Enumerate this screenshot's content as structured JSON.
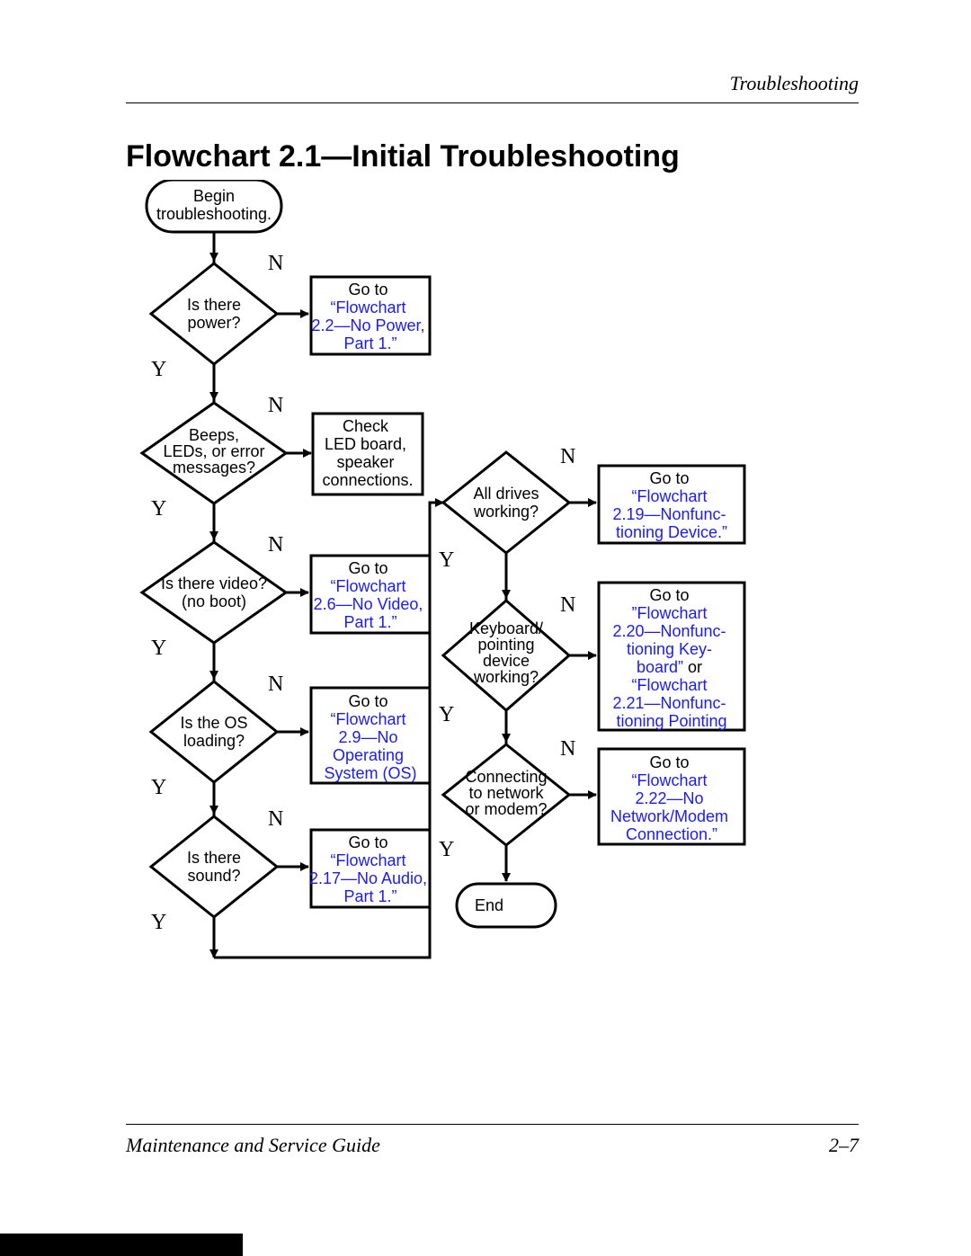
{
  "header": "Troubleshooting",
  "title": "Flowchart 2.1—Initial Troubleshooting",
  "footer_left": "Maintenance and Service Guide",
  "footer_right": "2–7",
  "labels": {
    "yes": "Y",
    "no": "N"
  },
  "chart_data": {
    "type": "table",
    "nodes": {
      "begin": {
        "kind": "terminator",
        "text": "Begin\ntroubleshooting."
      },
      "power": {
        "kind": "decision",
        "text": "Is there\npower?"
      },
      "power_ref": {
        "kind": "process",
        "plain": "Go to",
        "link": "“Flowchart\n2.2—No Power,\nPart 1.”"
      },
      "beeps": {
        "kind": "decision",
        "text": "Beeps,\nLEDs, or error\nmessages?"
      },
      "beeps_ref": {
        "kind": "process",
        "plain": "Check\nLED board,\nspeaker\nconnections."
      },
      "video": {
        "kind": "decision",
        "text": "Is there video?\n(no boot)"
      },
      "video_ref": {
        "kind": "process",
        "plain": "Go to",
        "link": "“Flowchart\n2.6—No Video,\nPart 1.”"
      },
      "os": {
        "kind": "decision",
        "text": "Is the OS\nloading?"
      },
      "os_ref": {
        "kind": "process",
        "plain": "Go to",
        "link": "“Flowchart\n2.9—No\nOperating\nSystem (OS)"
      },
      "sound": {
        "kind": "decision",
        "text": "Is there\nsound?"
      },
      "sound_ref": {
        "kind": "process",
        "plain": "Go to",
        "link": "“Flowchart\n2.17—No Audio,\nPart 1.”"
      },
      "drives": {
        "kind": "decision",
        "text": "All drives\nworking?"
      },
      "drives_ref": {
        "kind": "process",
        "plain": "Go to",
        "link": "“Flowchart\n2.19—Nonfunc-\ntioning Device.”"
      },
      "kbd": {
        "kind": "decision",
        "text": "Keyboard/\npointing\ndevice\nworking?"
      },
      "kbd_ref": {
        "kind": "process",
        "plain": "Go to",
        "link1": "”Flowchart\n2.20—Nonfunc-\ntioning Key-\nboard”",
        "mid": " or",
        "link2": "“Flowchart\n2.21—Nonfunc-\ntioning Pointing"
      },
      "net": {
        "kind": "decision",
        "text": "Connecting\nto network\nor modem?"
      },
      "net_ref": {
        "kind": "process",
        "plain": "Go to",
        "link": "“Flowchart\n2.22—No\nNetwork/Modem\nConnection.”"
      },
      "end": {
        "kind": "terminator",
        "text": "End"
      }
    },
    "edges": [
      {
        "from": "begin",
        "to": "power"
      },
      {
        "from": "power",
        "to": "beeps",
        "label": "Y"
      },
      {
        "from": "power",
        "to": "power_ref",
        "label": "N"
      },
      {
        "from": "beeps",
        "to": "video",
        "label": "Y"
      },
      {
        "from": "beeps",
        "to": "beeps_ref",
        "label": "N"
      },
      {
        "from": "video",
        "to": "os",
        "label": "Y"
      },
      {
        "from": "video",
        "to": "video_ref",
        "label": "N"
      },
      {
        "from": "os",
        "to": "sound",
        "label": "Y"
      },
      {
        "from": "os",
        "to": "os_ref",
        "label": "N"
      },
      {
        "from": "sound",
        "to": "drives",
        "label": "Y"
      },
      {
        "from": "sound",
        "to": "sound_ref",
        "label": "N"
      },
      {
        "from": "drives",
        "to": "kbd",
        "label": "Y"
      },
      {
        "from": "drives",
        "to": "drives_ref",
        "label": "N"
      },
      {
        "from": "kbd",
        "to": "net",
        "label": "Y"
      },
      {
        "from": "kbd",
        "to": "kbd_ref",
        "label": "N"
      },
      {
        "from": "net",
        "to": "end",
        "label": "Y"
      },
      {
        "from": "net",
        "to": "net_ref",
        "label": "N"
      }
    ]
  }
}
